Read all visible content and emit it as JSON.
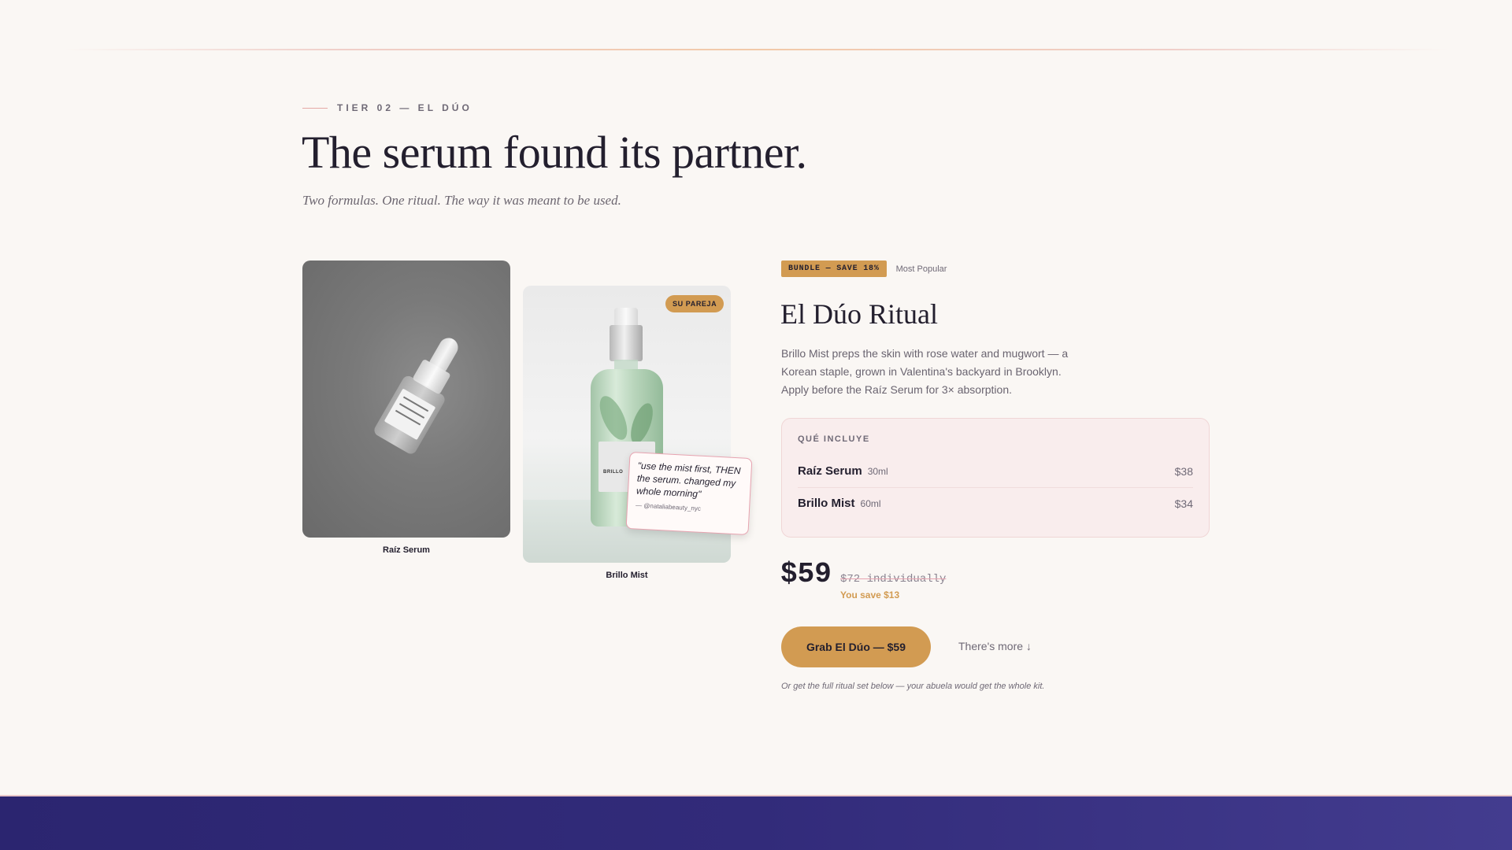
{
  "eyebrow": "TIER 02 — EL DÚO",
  "headline": "The serum found its partner.",
  "subhead": "Two formulas. One ritual. The way it was meant to be used.",
  "products": {
    "raiz_label": "Raíz Serum",
    "brillo_label": "Brillo Mist",
    "brillo_bottle_text": "BRILLO",
    "brillo_badge": "SU PAREJA"
  },
  "quote": {
    "text": "\"use the mist first, THEN the serum. changed my whole morning\"",
    "author": "— @nataliabeauty_nyc"
  },
  "bundle": {
    "badge": "BUNDLE — SAVE 18%",
    "tag": "Most Popular",
    "title": "El Dúo Ritual",
    "description": "Brillo Mist preps the skin with rose water and mugwort — a Korean staple, grown in Valentina's backyard in Brooklyn. Apply before the Raíz Serum for 3× absorption."
  },
  "includes": {
    "title": "QUÉ INCLUYE",
    "items": [
      {
        "name": "Raíz Serum",
        "size": "30ml",
        "price": "$38"
      },
      {
        "name": "Brillo Mist",
        "size": "60ml",
        "price": "$34"
      }
    ]
  },
  "pricing": {
    "price": "$59",
    "old_price": "$72 individually",
    "savings": "You save $13"
  },
  "cta": {
    "button": "Grab El Dúo — $59",
    "secondary": "There's more ↓",
    "note": "Or get the full ritual set below — your abuela would get the whole kit."
  },
  "colors": {
    "accent": "#d29b52",
    "ink": "#231f2e",
    "background": "#faf7f4",
    "pink": "#e7a3b0",
    "footer": "#2b2570"
  }
}
